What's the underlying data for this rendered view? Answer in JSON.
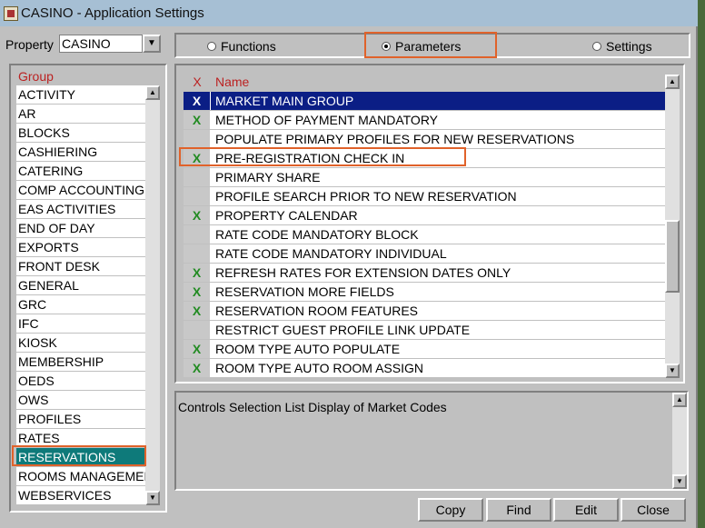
{
  "window": {
    "title": "CASINO - Application Settings"
  },
  "property": {
    "label": "Property",
    "value": "CASINO"
  },
  "radios": {
    "functions": "Functions",
    "parameters": "Parameters",
    "settings": "Settings",
    "selected": "parameters"
  },
  "group": {
    "header": "Group",
    "items": [
      "ACTIVITY",
      "AR",
      "BLOCKS",
      "CASHIERING",
      "CATERING",
      "COMP ACCOUNTING",
      "EAS ACTIVITIES",
      "END OF DAY",
      "EXPORTS",
      "FRONT DESK",
      "GENERAL",
      "GRC",
      "IFC",
      "KIOSK",
      "MEMBERSHIP",
      "OEDS",
      "OWS",
      "PROFILES",
      "RATES",
      "RESERVATIONS",
      "ROOMS MANAGEMENT",
      "WEBSERVICES"
    ],
    "selected": "RESERVATIONS"
  },
  "params": {
    "header_x": "X",
    "header_name": "Name",
    "rows": [
      {
        "x": "X",
        "name": "MARKET MAIN GROUP"
      },
      {
        "x": "X",
        "name": "METHOD OF PAYMENT MANDATORY"
      },
      {
        "x": "",
        "name": "POPULATE PRIMARY PROFILES FOR NEW RESERVATIONS"
      },
      {
        "x": "X",
        "name": "PRE-REGISTRATION CHECK IN"
      },
      {
        "x": "",
        "name": "PRIMARY SHARE"
      },
      {
        "x": "",
        "name": "PROFILE SEARCH PRIOR TO NEW RESERVATION"
      },
      {
        "x": "X",
        "name": "PROPERTY CALENDAR"
      },
      {
        "x": "",
        "name": "RATE CODE MANDATORY BLOCK"
      },
      {
        "x": "",
        "name": "RATE CODE MANDATORY INDIVIDUAL"
      },
      {
        "x": "X",
        "name": "REFRESH RATES FOR EXTENSION DATES ONLY"
      },
      {
        "x": "X",
        "name": "RESERVATION MORE FIELDS"
      },
      {
        "x": "X",
        "name": "RESERVATION ROOM FEATURES"
      },
      {
        "x": "",
        "name": "RESTRICT GUEST PROFILE LINK UPDATE"
      },
      {
        "x": "X",
        "name": "ROOM TYPE AUTO POPULATE"
      },
      {
        "x": "X",
        "name": "ROOM TYPE AUTO ROOM ASSIGN"
      }
    ],
    "selected": "MARKET MAIN GROUP"
  },
  "description": {
    "text": "Controls Selection List Display of Market Codes"
  },
  "buttons": {
    "copy": "Copy",
    "find": "Find",
    "edit": "Edit",
    "close": "Close"
  },
  "colors": {
    "selection_navy": "#0b1e85",
    "selection_teal": "#0e7a7a",
    "highlight": "#e0622a",
    "check_green": "#228b22"
  }
}
